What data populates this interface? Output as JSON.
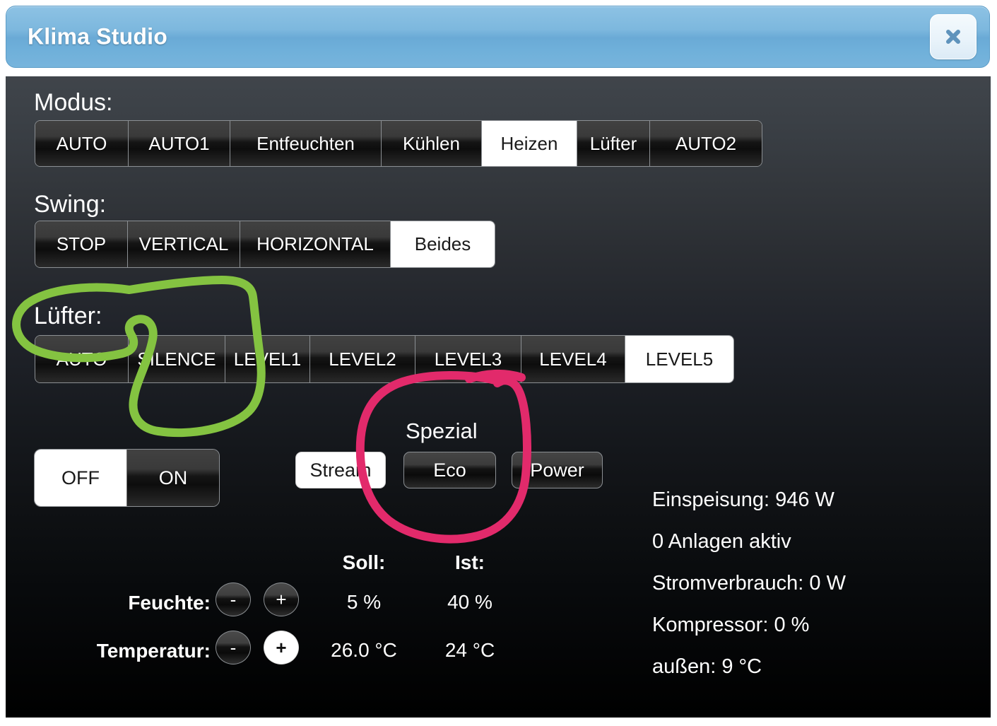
{
  "window": {
    "title": "Klima Studio",
    "close_icon": "close-x-icon",
    "titlebar_color": "#7db8de",
    "panel_bg_top": "#40454b",
    "panel_bg_bottom": "#000000"
  },
  "sections": {
    "modus": {
      "label": "Modus:",
      "options": [
        "AUTO",
        "AUTO1",
        "Entfeuchten",
        "Kühlen",
        "Heizen",
        "Lüfter",
        "AUTO2"
      ],
      "selected": "Heizen"
    },
    "swing": {
      "label": "Swing:",
      "options": [
        "STOP",
        "VERTICAL",
        "HORIZONTAL",
        "Beides"
      ],
      "selected": "Beides"
    },
    "luefter": {
      "label": "Lüfter:",
      "options": [
        "AUTO",
        "SILENCE",
        "LEVEL1",
        "LEVEL2",
        "LEVEL3",
        "LEVEL4",
        "LEVEL5"
      ],
      "selected": "LEVEL5"
    }
  },
  "power_toggle": {
    "options": [
      "OFF",
      "ON"
    ],
    "selected": "OFF"
  },
  "spezial": {
    "label": "Spezial",
    "buttons": [
      {
        "label": "Stream",
        "active": true
      },
      {
        "label": "Eco",
        "active": false
      },
      {
        "label": "Power",
        "active": false
      }
    ]
  },
  "setpoints": {
    "col_headers": {
      "soll": "Soll:",
      "ist": "Ist:"
    },
    "rows": [
      {
        "label": "Feuchte:",
        "minus": "-",
        "plus": "+",
        "minus_active": false,
        "plus_active": false,
        "soll": "5 %",
        "ist": "40 %"
      },
      {
        "label": "Temperatur:",
        "minus": "-",
        "plus": "+",
        "minus_active": false,
        "plus_active": true,
        "soll": "26.0 °C",
        "ist": "24 °C"
      }
    ]
  },
  "status": {
    "lines": [
      "Einspeisung: 946 W",
      "0 Anlagen aktiv",
      "Stromverbrauch: 0 W",
      "Kompressor: 0 %",
      "außen: 9 °C"
    ]
  },
  "annotations": [
    {
      "name": "green-circle-luefter-silence",
      "color": "#84c341",
      "stroke_width": 11,
      "targets": [
        "Lüfter: label",
        "SILENCE button"
      ]
    },
    {
      "name": "pink-circle-spezial-eco",
      "color": "#e22a6b",
      "stroke_width": 11,
      "targets": [
        "Spezial label",
        "Eco button"
      ]
    }
  ]
}
